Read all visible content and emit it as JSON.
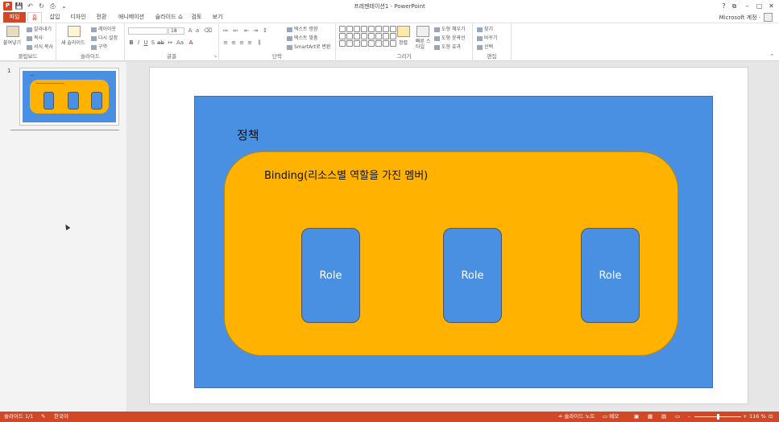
{
  "window": {
    "title": "프레젠테이션1 - PowerPoint",
    "controls": [
      "?",
      "⧉",
      "–",
      "▢",
      "✕"
    ]
  },
  "quick_access": [
    "P",
    "💾",
    "↶",
    "↻",
    "⎙",
    "⌄"
  ],
  "tabs": [
    {
      "label": "파일"
    },
    {
      "label": "홈"
    },
    {
      "label": "삽입"
    },
    {
      "label": "디자인"
    },
    {
      "label": "전환"
    },
    {
      "label": "애니메이션"
    },
    {
      "label": "슬라이드 쇼"
    },
    {
      "label": "검토"
    },
    {
      "label": "보기"
    }
  ],
  "account": {
    "label": "Microsoft 계정 ·"
  },
  "ribbon": {
    "clipboard": {
      "label": "클립보드",
      "paste": "붙여넣기",
      "cut": "잘라내기",
      "copy": "복사",
      "format_painter": "서식 복사"
    },
    "slides": {
      "label": "슬라이드",
      "new_slide": "새 슬라이드",
      "layout": "레이아웃",
      "reset": "다시 설정",
      "section": "구역"
    },
    "font": {
      "label": "글꼴",
      "font_size": "18"
    },
    "paragraph": {
      "label": "단락",
      "text_direction": "텍스트 방향",
      "align_text": "텍스트 맞춤",
      "smartart": "SmartArt로 변환"
    },
    "drawing": {
      "label": "그리기",
      "arrange": "정렬",
      "quick_styles": "빠른 스타일",
      "shape_fill": "도형 채우기",
      "shape_outline": "도형 윤곽선",
      "shape_effects": "도형 효과"
    },
    "editing": {
      "label": "편집",
      "find": "찾기",
      "replace": "바꾸기",
      "select": "선택"
    }
  },
  "thumbnail": {
    "number": "1"
  },
  "slide": {
    "policy": "정책",
    "binding": "Binding(리소스별 역할을 가진 멤버)",
    "roles": [
      "Role",
      "Role",
      "Role"
    ]
  },
  "statusbar": {
    "slide_count": "슬라이드 1/1",
    "language": "한국어",
    "notes": "슬라이드 노트",
    "comments": "메모",
    "zoom": "116 %"
  },
  "colors": {
    "accent": "#d24726",
    "slide_background": "#4a90e2",
    "binding_fill": "#ffb300",
    "role_fill": "#4a90e2"
  }
}
